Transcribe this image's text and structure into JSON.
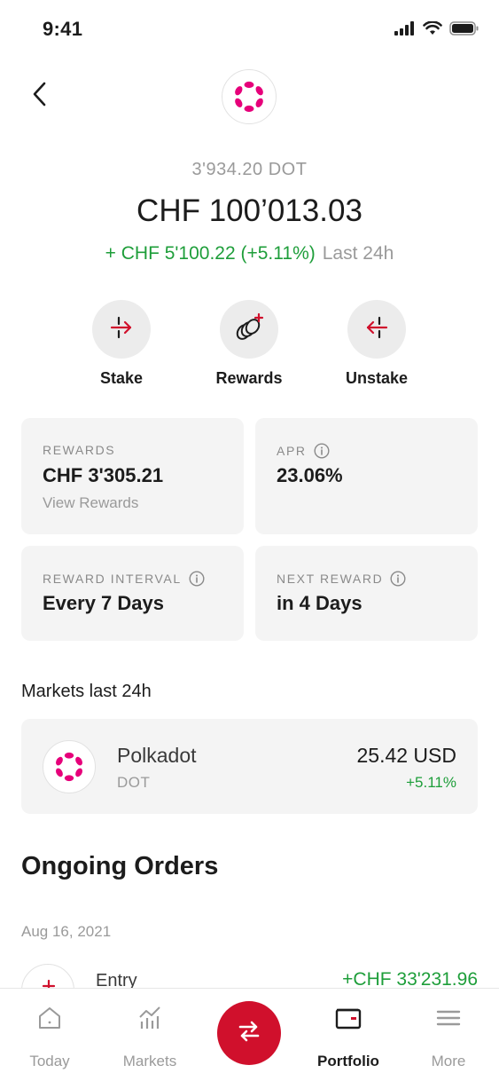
{
  "status_bar": {
    "time": "9:41"
  },
  "header": {
    "back_icon": "chevron-left-icon",
    "coin_icon": "polkadot-logo"
  },
  "balance": {
    "amount_dot": "3'934.20 DOT",
    "amount_fiat": "CHF 100’013.03",
    "change_value": "+ CHF 5'100.22 (+5.11%)",
    "change_period": "Last 24h"
  },
  "actions": [
    {
      "label": "Stake",
      "icon": "stake-arrow-icon"
    },
    {
      "label": "Rewards",
      "icon": "rewards-coins-icon"
    },
    {
      "label": "Unstake",
      "icon": "unstake-arrow-icon"
    }
  ],
  "stats": {
    "rewards": {
      "label": "REWARDS",
      "value": "CHF 3'305.21",
      "link": "View Rewards"
    },
    "apr": {
      "label": "APR",
      "value": "23.06%"
    },
    "reward_interval": {
      "label": "REWARD INTERVAL",
      "value": "Every 7 Days"
    },
    "next_reward": {
      "label": "NEXT REWARD",
      "value": "in 4 Days"
    }
  },
  "markets": {
    "title": "Markets last 24h",
    "item": {
      "name": "Polkadot",
      "ticker": "DOT",
      "price": "25.42 USD",
      "change": "+5.11%"
    }
  },
  "orders": {
    "title": "Ongoing Orders",
    "date": "Aug 16, 2021",
    "item": {
      "type": "Entry",
      "amount": "+CHF 33'231.96"
    }
  },
  "tab_bar": {
    "tabs": [
      {
        "label": "Today",
        "icon": "home-icon"
      },
      {
        "label": "Markets",
        "icon": "chart-icon"
      },
      {
        "label": "Portfolio",
        "icon": "wallet-icon",
        "active": true
      },
      {
        "label": "More",
        "icon": "menu-icon"
      }
    ],
    "center_action_icon": "swap-icon"
  },
  "colors": {
    "accent": "#d0102c",
    "positive": "#1e9e3a",
    "polkadot": "#e6007a"
  }
}
